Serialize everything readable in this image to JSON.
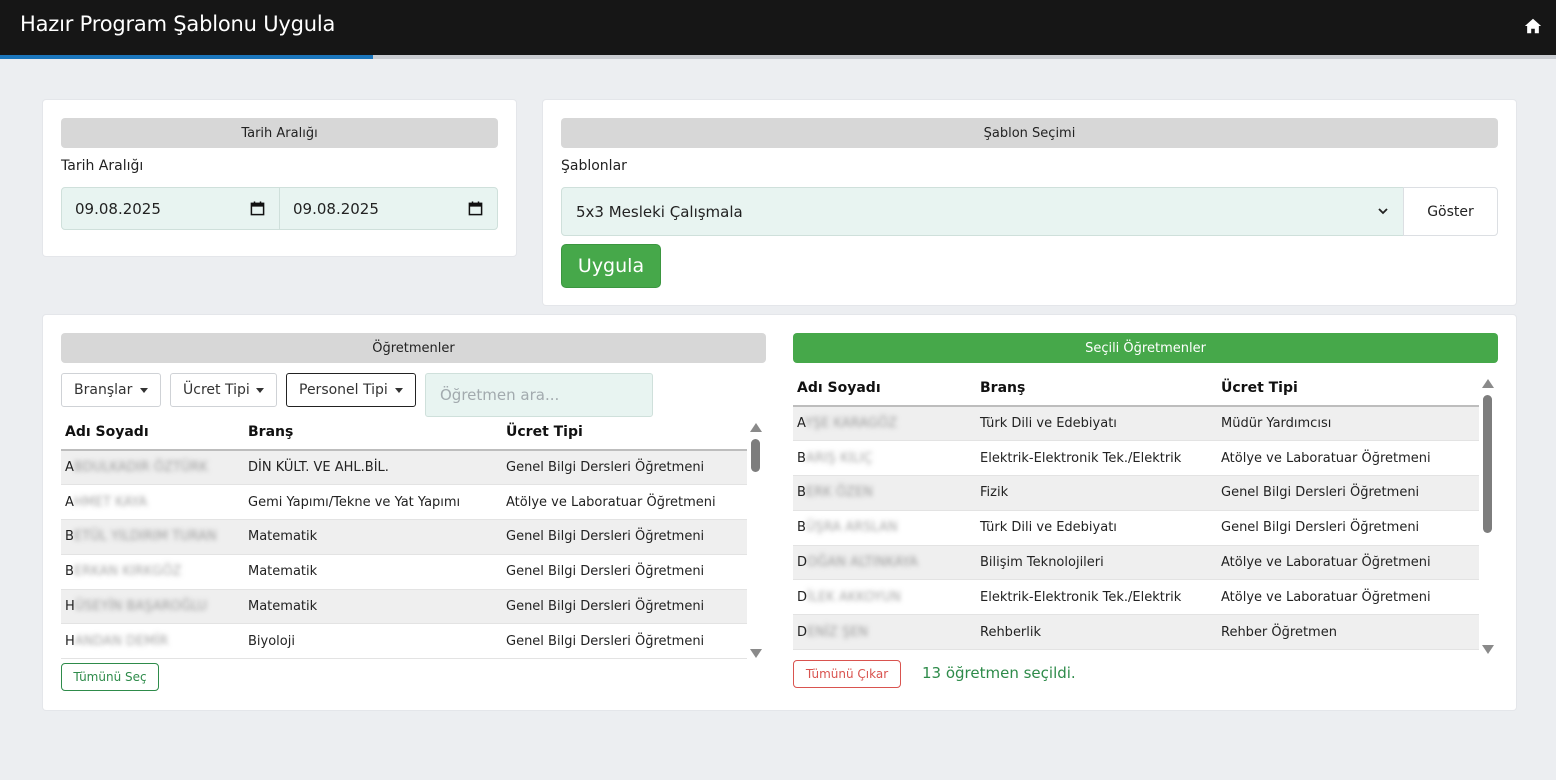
{
  "header": {
    "title": "Hazır Program Şablonu Uygula",
    "home_icon": "home-icon",
    "progress_percent": 24
  },
  "date_section": {
    "header": "Tarih Aralığı",
    "label": "Tarih Aralığı",
    "start_date": "09.08.2025",
    "end_date": "09.08.2025",
    "calendar_icon": "calendar-icon"
  },
  "template_section": {
    "header": "Şablon Seçimi",
    "label": "Şablonlar",
    "selected": "5x3 Mesleki Çalışmala",
    "show_button": "Göster",
    "apply_button": "Uygula"
  },
  "teachers": {
    "header": "Öğretmenler",
    "filters": {
      "branches": "Branşlar",
      "fee_type": "Ücret Tipi",
      "staff_type": "Personel Tipi"
    },
    "search_placeholder": "Öğretmen ara...",
    "columns": [
      "Adı Soyadı",
      "Branş",
      "Ücret Tipi"
    ],
    "rows": [
      {
        "name": "A",
        "name_hidden": "BDULKADIR ÖZTÜRK",
        "branch": "DİN KÜLT. VE AHL.BİL.",
        "fee": "Genel Bilgi Dersleri Öğretmeni"
      },
      {
        "name": "A",
        "name_hidden": "HMET KAYA",
        "branch": "Gemi Yapımı/Tekne ve Yat Yapımı",
        "fee": "Atölye ve Laboratuar Öğretmeni"
      },
      {
        "name": "B",
        "name_hidden": "ETÜL YILDIRIM TURAN",
        "branch": "Matematik",
        "fee": "Genel Bilgi Dersleri Öğretmeni"
      },
      {
        "name": "B",
        "name_hidden": "ERKAN KIRKGÖZ",
        "branch": "Matematik",
        "fee": "Genel Bilgi Dersleri Öğretmeni"
      },
      {
        "name": "H",
        "name_hidden": "ÜSEYİN BAŞAROĞLU",
        "branch": "Matematik",
        "fee": "Genel Bilgi Dersleri Öğretmeni"
      },
      {
        "name": "H",
        "name_hidden": "ANDAN DEMİR",
        "branch": "Biyoloji",
        "fee": "Genel Bilgi Dersleri Öğretmeni"
      }
    ],
    "select_all": "Tümünü Seç"
  },
  "selected_teachers": {
    "header": "Seçili Öğretmenler",
    "columns": [
      "Adı Soyadı",
      "Branş",
      "Ücret Tipi"
    ],
    "rows": [
      {
        "name": "A",
        "name_hidden": "YŞE KARAGÖZ",
        "branch": "Türk Dili ve Edebiyatı",
        "fee": "Müdür Yardımcısı"
      },
      {
        "name": "B",
        "name_hidden": "ARIŞ KILIÇ",
        "branch": "Elektrik-Elektronik Tek./Elektrik",
        "fee": "Atölye ve Laboratuar Öğretmeni"
      },
      {
        "name": "B",
        "name_hidden": "ERK ÖZEN",
        "branch": "Fizik",
        "fee": "Genel Bilgi Dersleri Öğretmeni"
      },
      {
        "name": "B",
        "name_hidden": "ÜŞRA ARSLAN",
        "branch": "Türk Dili ve Edebiyatı",
        "fee": "Genel Bilgi Dersleri Öğretmeni"
      },
      {
        "name": "D",
        "name_hidden": "OĞAN ALTINKAYA",
        "branch": "Bilişim Teknolojileri",
        "fee": "Atölye ve Laboratuar Öğretmeni"
      },
      {
        "name": "D",
        "name_hidden": "İLEK AKKOYUN",
        "branch": "Elektrik-Elektronik Tek./Elektrik",
        "fee": "Atölye ve Laboratuar Öğretmeni"
      },
      {
        "name": "D",
        "name_hidden": "ENİZ ŞEN",
        "branch": "Rehberlik",
        "fee": "Rehber Öğretmen"
      }
    ],
    "remove_all": "Tümünü Çıkar",
    "status": "13 öğretmen seçildi."
  },
  "colors": {
    "accent_green": "#46a84a",
    "top_bar": "#161616",
    "progress_blue": "#1b76bc"
  }
}
